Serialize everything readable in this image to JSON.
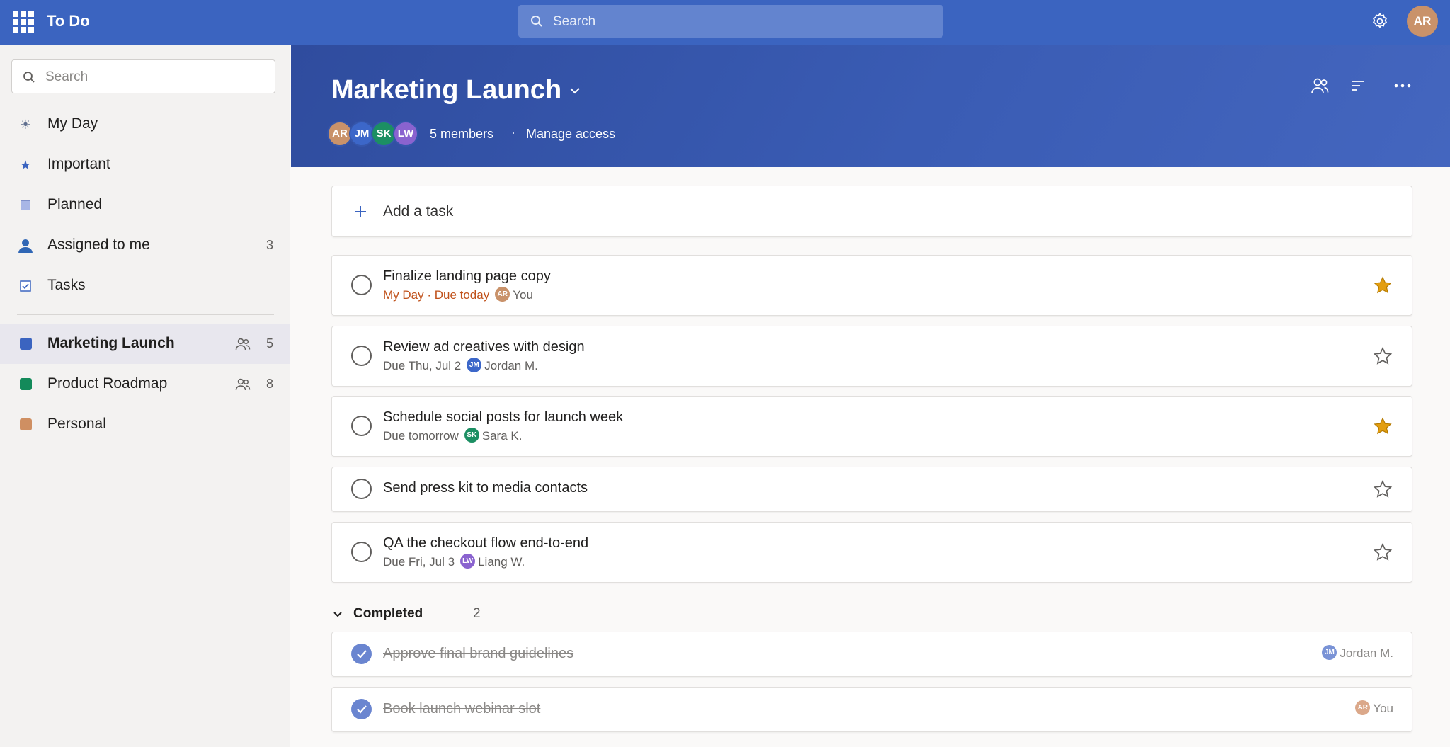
{
  "app": {
    "title": "To Do"
  },
  "topbar": {
    "search_placeholder": "Search",
    "user_initials": "AR"
  },
  "sidebar": {
    "search_placeholder": "Search",
    "smart_lists": [
      {
        "label": "My Day",
        "icon": "sun-icon"
      },
      {
        "label": "Important",
        "icon": "star-icon"
      },
      {
        "label": "Planned",
        "icon": "calendar-icon"
      },
      {
        "label": "Assigned to me",
        "icon": "person-icon",
        "count": "3"
      },
      {
        "label": "Tasks",
        "icon": "checkbox-icon"
      }
    ],
    "lists": [
      {
        "label": "Marketing Launch",
        "color": "#3b64c0",
        "shared_count": "5",
        "active": true
      },
      {
        "label": "Product Roadmap",
        "color": "#138a5a",
        "shared_count": "8"
      },
      {
        "label": "Personal",
        "color": "#cf8f62"
      }
    ]
  },
  "header": {
    "title": "Marketing Launch",
    "members": [
      {
        "initials": "AR",
        "color": "#c9926a"
      },
      {
        "initials": "JM",
        "color": "#3c67c9"
      },
      {
        "initials": "SK",
        "color": "#1c8f63"
      },
      {
        "initials": "LW",
        "color": "#8a63cf"
      }
    ],
    "members_label": "5 members",
    "separator": "·",
    "manage_access": "Manage access"
  },
  "add_task": {
    "label": "Add a task"
  },
  "tasks": [
    {
      "title": "Finalize landing page copy",
      "meta_urgent": "My Day · Due today",
      "meta": "",
      "assignee_initials": "AR",
      "assignee_color": "#c9926a",
      "assignee": "You",
      "starred": true
    },
    {
      "title": "Review ad creatives with design",
      "meta_urgent": "",
      "meta": "Due Thu, Jul 2",
      "assignee_initials": "JM",
      "assignee_color": "#3c67c9",
      "assignee": "Jordan M.",
      "starred": false
    },
    {
      "title": "Schedule social posts for launch week",
      "meta_urgent": "",
      "meta": "Due tomorrow",
      "assignee_initials": "SK",
      "assignee_color": "#1c8f63",
      "assignee": "Sara K.",
      "starred": true
    },
    {
      "title": "Send press kit to media contacts",
      "starred": false
    },
    {
      "title": "QA the checkout flow end-to-end",
      "meta_urgent": "",
      "meta": "Due Fri, Jul 3",
      "assignee_initials": "LW",
      "assignee_color": "#8a63cf",
      "assignee": "Liang W.",
      "starred": false
    }
  ],
  "completed": {
    "label": "Completed",
    "count": "2",
    "items": [
      {
        "title": "Approve final brand guidelines",
        "assignee_initials": "JM",
        "assignee_color": "#7a93d6",
        "assignee": "Jordan M."
      },
      {
        "title": "Book launch webinar slot",
        "assignee_initials": "AR",
        "assignee_color": "#dba88a",
        "assignee": "You"
      }
    ]
  },
  "colors": {
    "accent": "#3b64c0",
    "star": "#e39e10",
    "urgent": "#c0511a"
  }
}
